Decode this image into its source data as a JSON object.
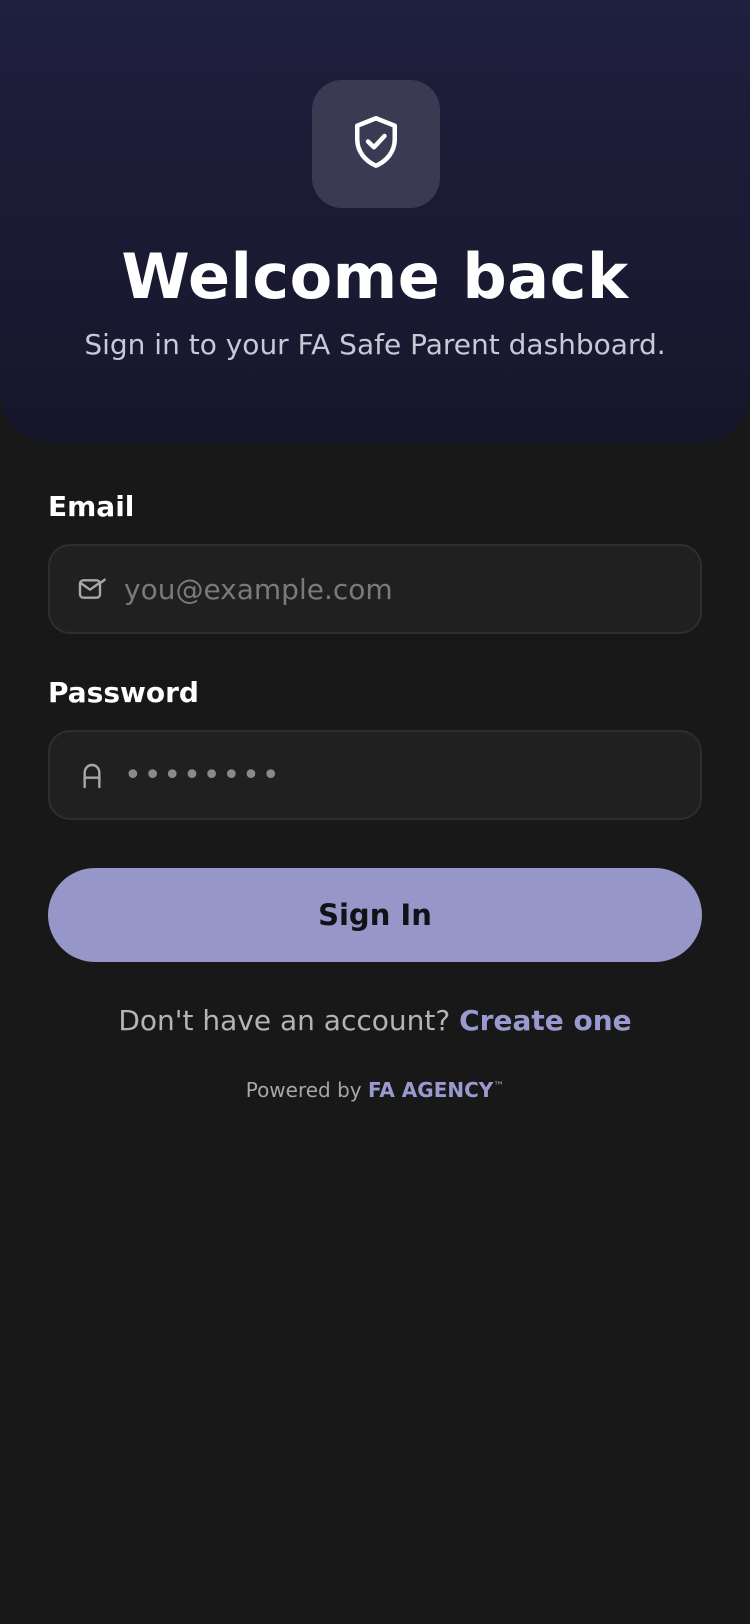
{
  "header": {
    "logo_icon": "shield-check-icon",
    "title": "Welcome back",
    "subtitle": "Sign in to your FA Safe Parent dashboard."
  },
  "form": {
    "email": {
      "label": "Email",
      "icon": "mail-icon",
      "placeholder": "you@example.com",
      "value": ""
    },
    "password": {
      "label": "Password",
      "icon": "lock-icon",
      "masked_value": "••••••••"
    },
    "submit_label": "Sign In"
  },
  "signup": {
    "prompt": "Don't have an account?",
    "link_label": "Create one"
  },
  "footer": {
    "powered_prefix": "Powered by",
    "brand": "FA AGENCY",
    "trademark": "™"
  },
  "colors": {
    "accent": "#9696c8",
    "link": "#9a9ad0",
    "background": "#181818",
    "hero": "#1f1f3f"
  }
}
